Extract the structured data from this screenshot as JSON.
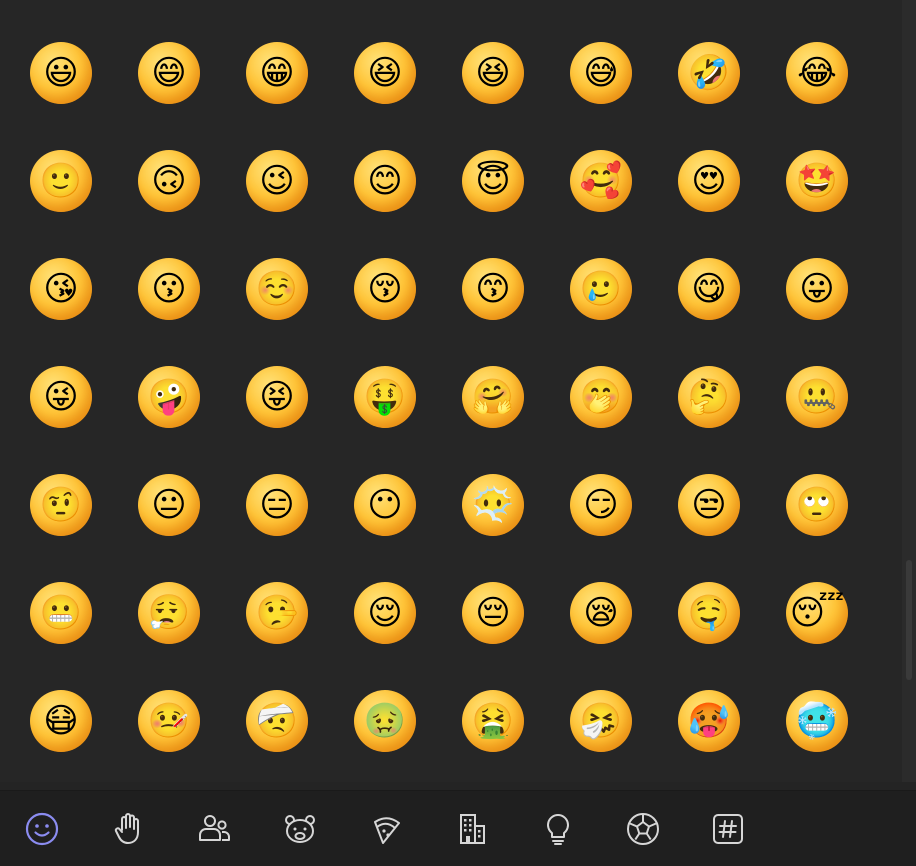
{
  "window": {
    "title": "Emoji picker"
  },
  "colors": {
    "background": "#262626",
    "toolbar_bg": "#1f1f1f",
    "accent": "#8b8cf0",
    "icon": "#d6d6d6",
    "face": "#ffc63a"
  },
  "emoji_grid": {
    "rows": [
      [
        "😃",
        "😄",
        "😁",
        "😆",
        "😆",
        "😅",
        "🤣",
        "😂"
      ],
      [
        "🙂",
        "🙃",
        "😉",
        "😊",
        "😇",
        "🥰",
        "😍",
        "🤩"
      ],
      [
        "😘",
        "😗",
        "☺️",
        "😚",
        "😙",
        "🥲",
        "😋",
        "😛"
      ],
      [
        "😜",
        "🤪",
        "😝",
        "🤑",
        "🤗",
        "🤭",
        "🤔",
        "🤐"
      ],
      [
        "🤨",
        "😐",
        "😑",
        "😶",
        "😶‍🌫️",
        "😏",
        "😒",
        "🙄"
      ],
      [
        "😬",
        "😮‍💨",
        "🤥",
        "😌",
        "😔",
        "😪",
        "🤤",
        "😴"
      ],
      [
        "😷",
        "🤒",
        "🤕",
        "🤢",
        "🤮",
        "🤧",
        "🥵",
        "🥶"
      ]
    ]
  },
  "categories": [
    {
      "name": "smileys-icon",
      "active": true
    },
    {
      "name": "hand-icon",
      "active": false
    },
    {
      "name": "people-icon",
      "active": false
    },
    {
      "name": "animal-icon",
      "active": false
    },
    {
      "name": "food-icon",
      "active": false
    },
    {
      "name": "building-icon",
      "active": false
    },
    {
      "name": "lightbulb-icon",
      "active": false
    },
    {
      "name": "soccer-ball-icon",
      "active": false
    },
    {
      "name": "hashtag-icon",
      "active": false
    }
  ]
}
